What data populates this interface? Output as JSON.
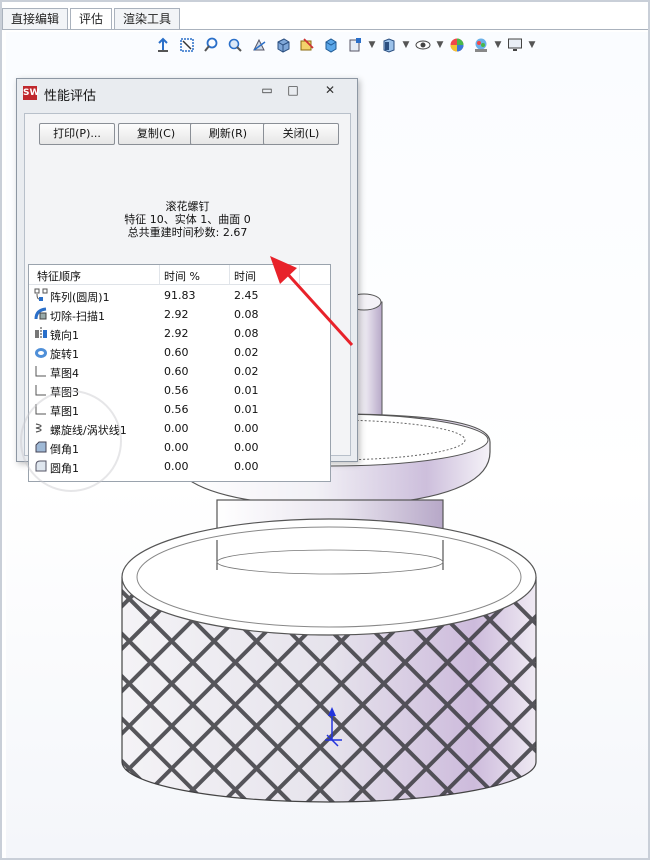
{
  "tabs": [
    "直接编辑",
    "评估",
    "渲染工具"
  ],
  "active_tab_index": 1,
  "hud_icons": [
    "zoom-to-fit-icon",
    "zoom-area-icon",
    "previous-view-icon",
    "section-view-icon",
    "dynamic-annotation-icon",
    "view-orientation-icon",
    "display-style-icon",
    "hide-show-icon",
    "edit-appearance-icon",
    "apply-scene-icon",
    "view-settings-icon",
    "monitor-icon"
  ],
  "dialog": {
    "title": "性能评估",
    "buttons": {
      "print": "打印(P)...",
      "copy": "复制(C)",
      "refresh": "刷新(R)",
      "close": "关闭(L)"
    },
    "part_name": "滚花螺钉",
    "summary": "特征 10、实体 1、曲面 0",
    "rebuild_time": "总共重建时间秒数: 2.67",
    "columns": {
      "order": "特征顺序",
      "percent": "时间 %",
      "time": "时间"
    },
    "rows": [
      {
        "name": "阵列(圆周)1",
        "percent": "91.83",
        "time": "2.45",
        "icon": "circular-pattern-icon"
      },
      {
        "name": "切除-扫描1",
        "percent": "2.92",
        "time": "0.08",
        "icon": "swept-cut-icon"
      },
      {
        "name": "镜向1",
        "percent": "2.92",
        "time": "0.08",
        "icon": "mirror-icon"
      },
      {
        "name": "旋转1",
        "percent": "0.60",
        "time": "0.02",
        "icon": "revolve-icon"
      },
      {
        "name": "草图4",
        "percent": "0.60",
        "time": "0.02",
        "icon": "sketch-icon"
      },
      {
        "name": "草图3",
        "percent": "0.56",
        "time": "0.01",
        "icon": "sketch-icon"
      },
      {
        "name": "草图1",
        "percent": "0.56",
        "time": "0.01",
        "icon": "sketch-icon"
      },
      {
        "name": "螺旋线/涡状线1",
        "percent": "0.00",
        "time": "0.00",
        "icon": "helix-icon"
      },
      {
        "name": "倒角1",
        "percent": "0.00",
        "time": "0.00",
        "icon": "chamfer-icon"
      },
      {
        "name": "圆角1",
        "percent": "0.00",
        "time": "0.00",
        "icon": "fillet-icon"
      }
    ]
  },
  "colors": {
    "arrow": "#e8222a",
    "accent": "#2a6fc9"
  }
}
